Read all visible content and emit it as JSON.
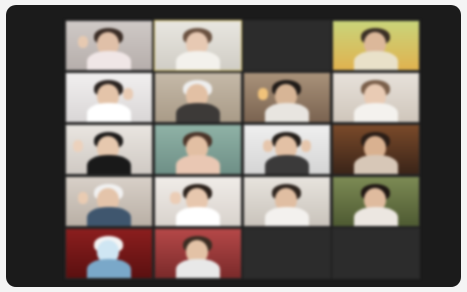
{
  "meeting": {
    "colors": {
      "frame_background": "#1b1b1b",
      "page_background": "#f4f4f4",
      "active_speaker_border": "#d7c36a",
      "video_off_tile": "#2c2c2c"
    }
  }
}
